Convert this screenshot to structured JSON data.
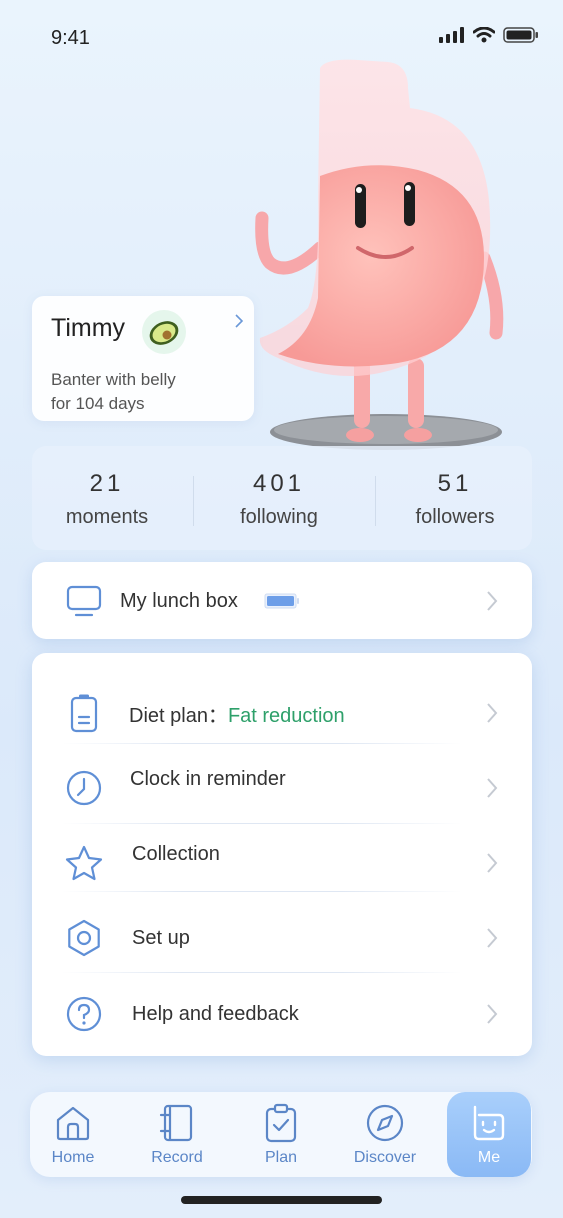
{
  "status_bar": {
    "time": "9:41"
  },
  "profile": {
    "name": "Timmy",
    "bio_line1": "Banter with belly",
    "bio_line2": "for 104 days"
  },
  "stats": [
    {
      "value": "21",
      "label": "moments"
    },
    {
      "value": "401",
      "label": "following"
    },
    {
      "value": "51",
      "label": "followers"
    }
  ],
  "lunch_box": {
    "label": "My lunch box"
  },
  "menu": {
    "diet_plan_label": "Diet plan：",
    "diet_plan_value": "Fat reduction",
    "clock_in": "Clock in reminder",
    "collection": "Collection",
    "set_up": "Set up",
    "help": "Help and feedback"
  },
  "tabs": [
    {
      "label": "Home",
      "icon": "home-icon"
    },
    {
      "label": "Record",
      "icon": "notebook-icon"
    },
    {
      "label": "Plan",
      "icon": "clipboard-check-icon"
    },
    {
      "label": "Discover",
      "icon": "compass-icon"
    },
    {
      "label": "Me",
      "icon": "smile-face-icon"
    }
  ],
  "colors": {
    "accent": "#5b86c7",
    "plan_value": "#2ea06a",
    "active_tab": "#9cc6f9"
  }
}
